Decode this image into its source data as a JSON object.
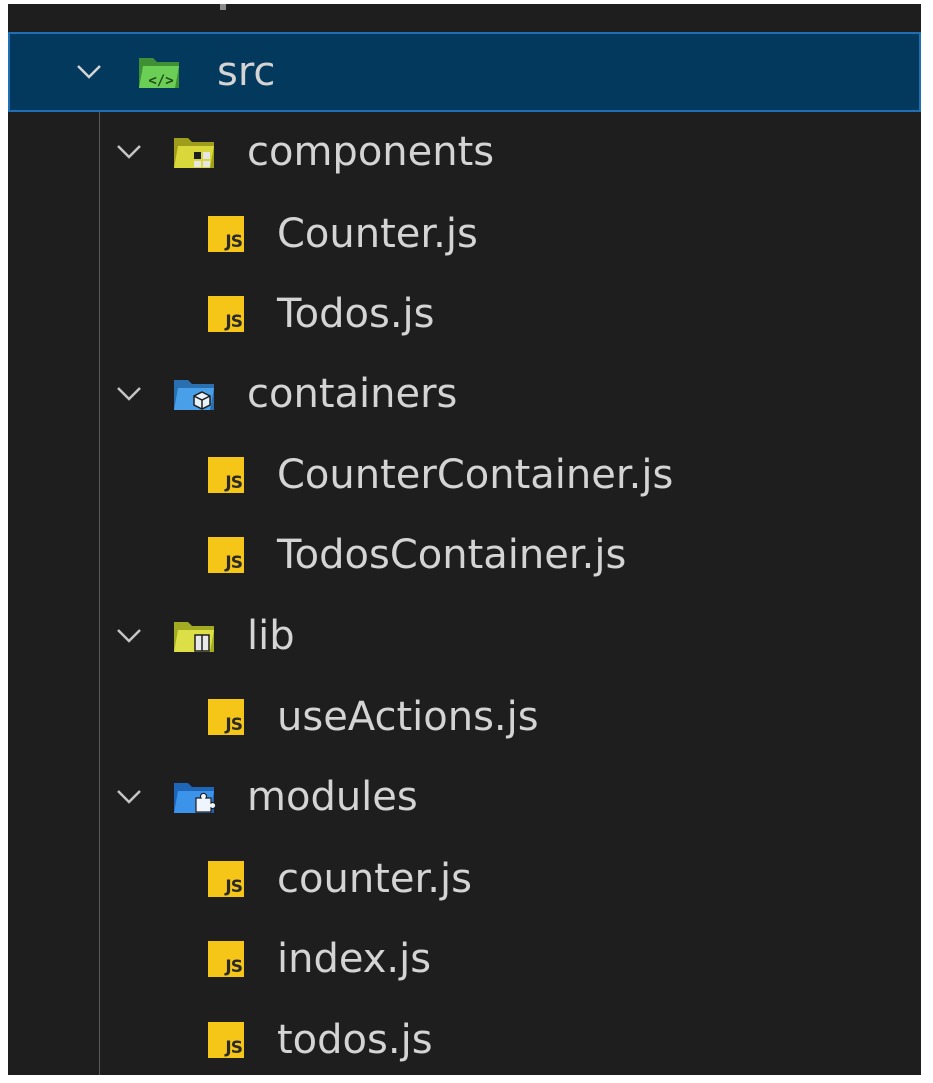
{
  "explorer": {
    "root": {
      "label": "src",
      "icon": "folder-src-open-icon",
      "expanded": true,
      "selected": true
    },
    "folders": [
      {
        "label": "components",
        "icon": "folder-components-open-icon",
        "color": "#c9c92a",
        "files": [
          {
            "label": "Counter.js",
            "icon": "javascript-file-icon"
          },
          {
            "label": "Todos.js",
            "icon": "javascript-file-icon"
          }
        ]
      },
      {
        "label": "containers",
        "icon": "folder-containers-open-icon",
        "color": "#3d8fd8",
        "files": [
          {
            "label": "CounterContainer.js",
            "icon": "javascript-file-icon"
          },
          {
            "label": "TodosContainer.js",
            "icon": "javascript-file-icon"
          }
        ]
      },
      {
        "label": "lib",
        "icon": "folder-lib-open-icon",
        "color": "#c9d23a",
        "files": [
          {
            "label": "useActions.js",
            "icon": "javascript-file-icon"
          }
        ]
      },
      {
        "label": "modules",
        "icon": "folder-modules-open-icon",
        "color": "#2f8be0",
        "files": [
          {
            "label": "counter.js",
            "icon": "javascript-file-icon"
          },
          {
            "label": "index.js",
            "icon": "javascript-file-icon"
          },
          {
            "label": "todos.js",
            "icon": "javascript-file-icon"
          }
        ]
      }
    ],
    "js_badge_text": "JS",
    "colors": {
      "background": "#1e1e1e",
      "selected_background": "#04395e",
      "selected_border": "#1f6fb5",
      "src_folder": "#5fb84a",
      "js_badge": "#f5c518"
    }
  }
}
